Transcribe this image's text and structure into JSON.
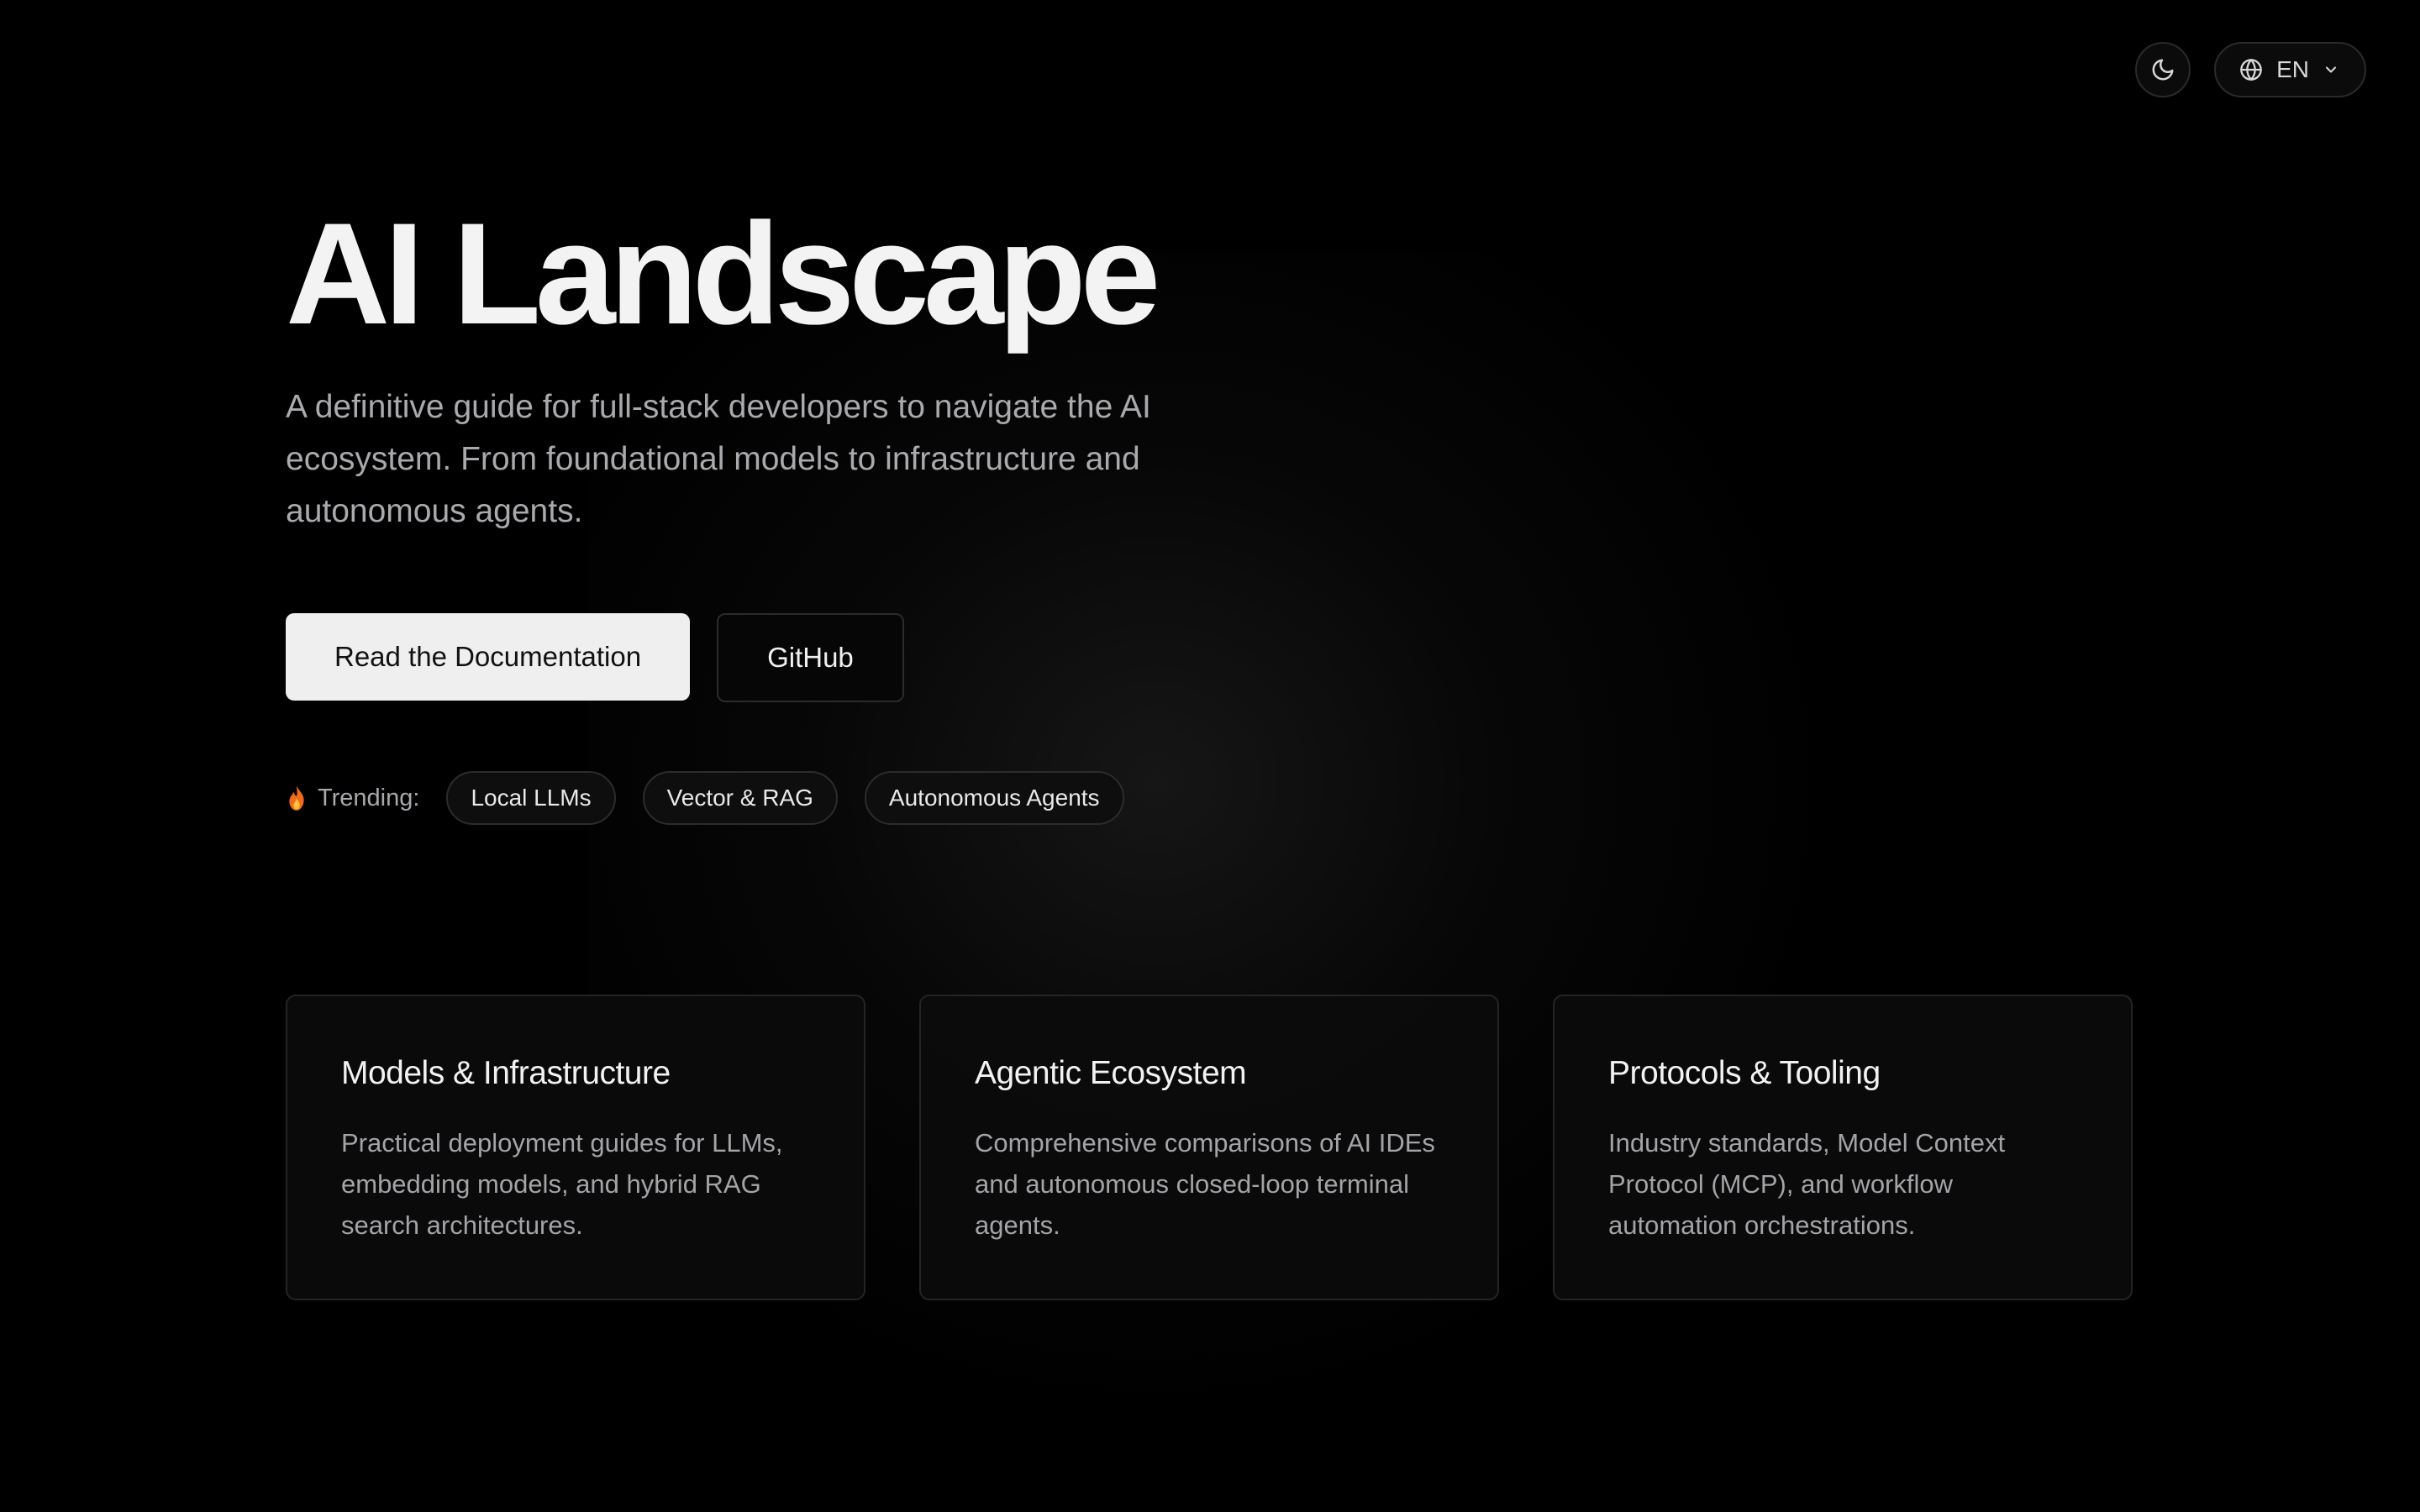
{
  "header": {
    "theme_icon": "moon-icon",
    "language": {
      "icon": "globe-icon",
      "value": "EN",
      "chevron": "chevron-down-icon"
    }
  },
  "hero": {
    "title": "AI Landscape",
    "subtitle": "A definitive guide for full-stack developers to navigate the AI ecosystem. From foundational models to infrastructure and autonomous agents.",
    "primary_cta": "Read the Documentation",
    "secondary_cta": "GitHub"
  },
  "trending": {
    "icon": "fire-icon",
    "label": "Trending:",
    "tags": [
      "Local LLMs",
      "Vector & RAG",
      "Autonomous Agents"
    ]
  },
  "cards": [
    {
      "title": "Models & Infrastructure",
      "description": "Practical deployment guides for LLMs, embedding models, and hybrid RAG search architectures."
    },
    {
      "title": "Agentic Ecosystem",
      "description": "Comprehensive comparisons of AI IDEs and autonomous closed-loop terminal agents."
    },
    {
      "title": "Protocols & Tooling",
      "description": "Industry standards, Model Context Protocol (MCP), and workflow automation orchestrations."
    }
  ],
  "colors": {
    "background": "#000000",
    "primary_button_bg": "#efefef",
    "text_primary": "#f2f2f2",
    "text_muted": "#a9a9ae",
    "border": "#2a2a2a",
    "fire_accent": "#f26a1b"
  }
}
